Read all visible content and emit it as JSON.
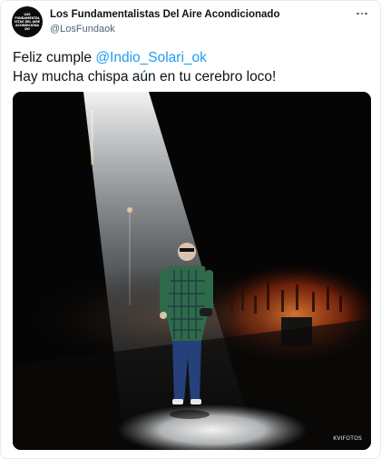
{
  "tweet": {
    "display_name": "Los Fundamentalistas Del Aire Acondicionado",
    "handle": "@LosFundaok",
    "avatar_text": "LOS FUNDAMENTALISTAS DEL AIRE ACONDICIONADO",
    "text_line1_prefix": "Feliz cumple ",
    "mention": "@Indio_Solari_ok",
    "text_line2": "Hay mucha chispa aún en tu cerebro loco!",
    "more_icon": "more-horizontal-icon",
    "media": {
      "photo_credit": "KVIFOTOS"
    }
  },
  "colors": {
    "link": "#1d9bf0",
    "text": "#0f1419",
    "secondary": "#536471",
    "shirt": "#2f6a4a",
    "stage_glow": "#e0541c"
  }
}
